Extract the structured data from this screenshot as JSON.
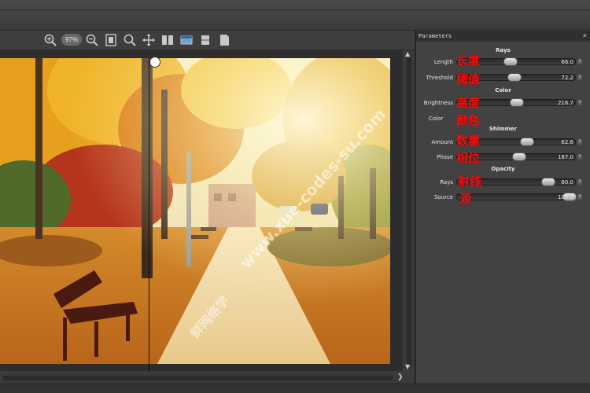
{
  "toolbar": {
    "zoom_value": "97%"
  },
  "panel": {
    "title": "Parameters",
    "close_glyph": "×",
    "sections": {
      "rays": "Rays",
      "color": "Color",
      "shimmer": "Shimmer",
      "opacity": "Opacity"
    },
    "params": {
      "length": {
        "label": "Length",
        "value": "66.0",
        "cn": "长度",
        "level": 0.44
      },
      "threshold": {
        "label": "Threshold",
        "value": "72.2",
        "cn": "阈值",
        "level": 0.48
      },
      "brightness": {
        "label": "Brightness",
        "value": "216.7",
        "cn": "高度",
        "level": 0.5
      },
      "color": {
        "label": "Color",
        "cn": "颜色"
      },
      "amount": {
        "label": "Amount",
        "value": "62.6",
        "cn": "数量",
        "level": 0.6
      },
      "phase": {
        "label": "Phase",
        "value": "187.0",
        "cn": "相位",
        "level": 0.52
      },
      "rays": {
        "label": "Rays",
        "value": "80.0",
        "cn": "射线",
        "level": 0.8
      },
      "source": {
        "label": "Source",
        "value": "100.0",
        "cn": "源",
        "level": 1.0
      }
    }
  },
  "watermark": {
    "text1": "www.xue-codes-su.com",
    "text2": "鲜网络学"
  },
  "icons": [
    "zoom-in-icon",
    "zoom-out-icon",
    "fit-icon",
    "magnifier-icon",
    "move-icon",
    "split-view-icon",
    "side-by-side-icon",
    "single-view-icon",
    "page-icon"
  ]
}
